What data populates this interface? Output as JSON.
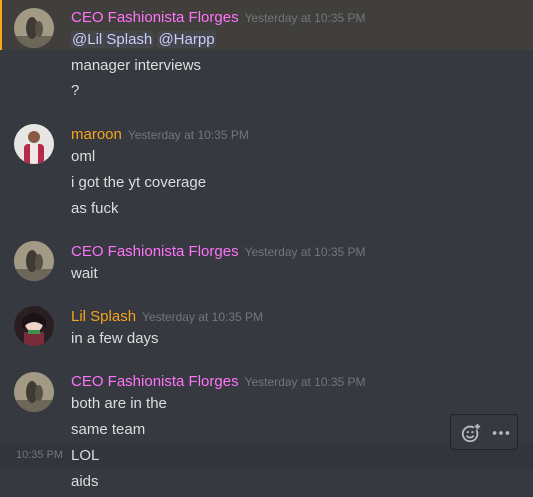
{
  "colors": {
    "fashionista": "#ff73fa",
    "maroon": "#f7a41d",
    "splash": "#f7a41d",
    "mention": "#c9cdfb",
    "timestamp": "#72767d"
  },
  "messages": [
    {
      "username": "CEO Fashionista Florges",
      "timestamp": "Yesterday at 10:35 PM",
      "mentions": [
        "@Lil Splash",
        "@Harpp"
      ],
      "lines": [
        "manager interviews",
        "?"
      ]
    },
    {
      "username": "maroon",
      "timestamp": "Yesterday at 10:35 PM",
      "lines": [
        "oml",
        "i got the yt coverage",
        "as fuck"
      ]
    },
    {
      "username": "CEO Fashionista Florges",
      "timestamp": "Yesterday at 10:35 PM",
      "lines": [
        "wait"
      ]
    },
    {
      "username": "Lil Splash",
      "timestamp": "Yesterday at 10:35 PM",
      "lines": [
        "in a few days"
      ]
    },
    {
      "username": "CEO Fashionista Florges",
      "timestamp": "Yesterday at 10:35 PM",
      "lines": [
        "both are in the",
        "same team",
        "LOL",
        "aids"
      ],
      "hover_time": "10:35 PM"
    }
  ],
  "icons": {
    "add_reaction": "add-reaction-icon",
    "more": "more-options-icon"
  }
}
